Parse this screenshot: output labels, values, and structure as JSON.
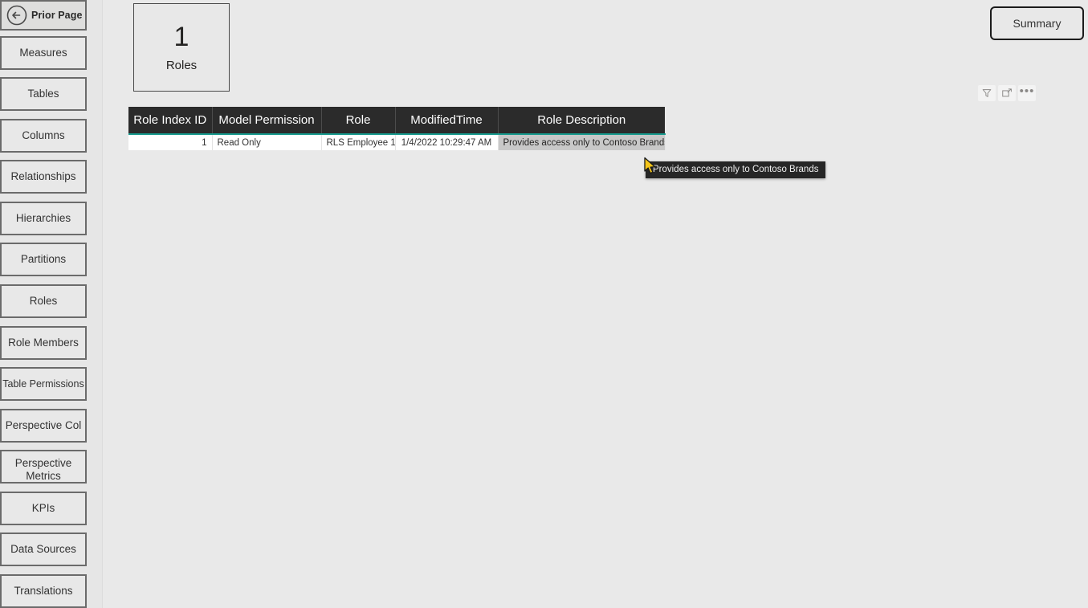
{
  "app": {
    "background_color": "#e9e9e9",
    "accent_color": "#179b8e",
    "header_color": "#2b2b2b"
  },
  "sidebar": {
    "prior_page": {
      "label": "Prior Page",
      "icon": "circle-arrow-left-icon"
    },
    "items": [
      {
        "label": "Measures"
      },
      {
        "label": "Tables"
      },
      {
        "label": "Columns"
      },
      {
        "label": "Relationships"
      },
      {
        "label": "Hierarchies"
      },
      {
        "label": "Partitions"
      },
      {
        "label": "Roles"
      },
      {
        "label": "Role Members"
      },
      {
        "label": "Table Permissions"
      },
      {
        "label": "Perspective Col"
      },
      {
        "label": "Perspective Metrics"
      },
      {
        "label": "KPIs"
      },
      {
        "label": "Data Sources"
      },
      {
        "label": "Translations"
      }
    ]
  },
  "card": {
    "value": "1",
    "label": "Roles"
  },
  "summary_button": {
    "label": "Summary"
  },
  "visual_header": {
    "filter_icon": "funnel-icon",
    "focus_icon": "focus-mode-icon",
    "more_icon": "more-options-icon",
    "more_glyph": "•••"
  },
  "table": {
    "columns": [
      "Role Index ID",
      "Model Permission",
      "Role",
      "ModifiedTime",
      "Role Description"
    ],
    "rows": [
      {
        "role_index_id": "1",
        "model_permission": "Read Only",
        "role": "RLS Employee 1",
        "modified_time": "1/4/2022 10:29:47 AM",
        "role_description": "Provides access only to Contoso Brands"
      }
    ]
  },
  "tooltip": {
    "text": "Provides access only to Contoso Brands"
  }
}
